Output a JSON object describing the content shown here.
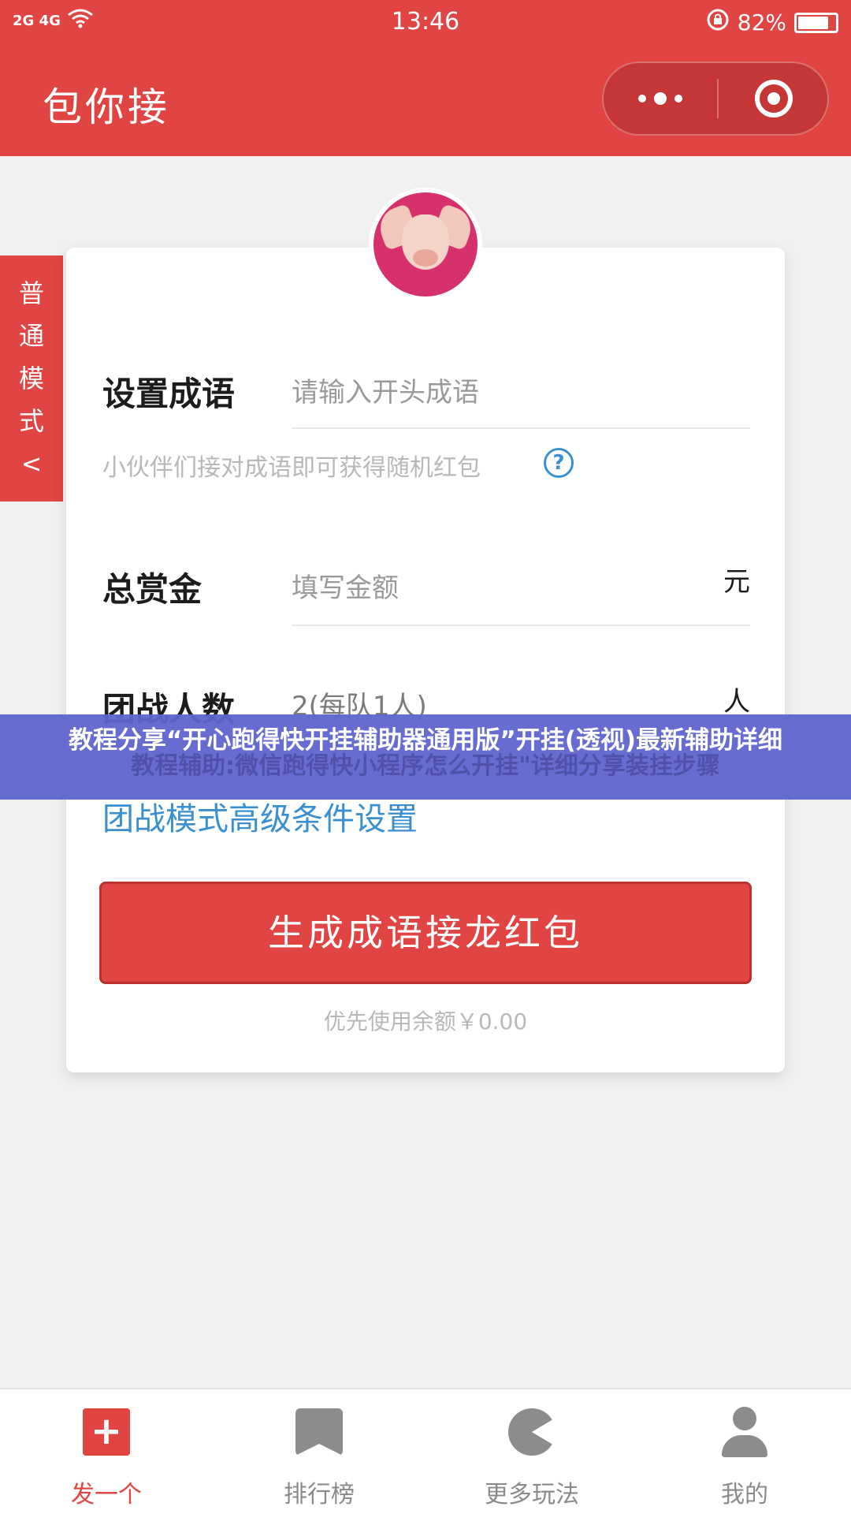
{
  "status_bar": {
    "network": "2G 4G",
    "time": "13:46",
    "battery_percent": "82%",
    "battery_level": 0.82
  },
  "header": {
    "title": "包你接"
  },
  "side_tab": {
    "chars": [
      "普",
      "通",
      "模",
      "式",
      "<"
    ]
  },
  "form": {
    "idiom_label": "设置成语",
    "idiom_placeholder": "请输入开头成语",
    "hint": "小伙伴们接对成语即可获得随机红包",
    "help_icon": "?",
    "amount_label": "总赏金",
    "amount_placeholder": "填写金额",
    "amount_unit": "元",
    "people_label": "团战人数",
    "people_value": "2(每队1人)",
    "people_unit": "人",
    "advanced_link": "团战模式高级条件设置",
    "submit_button": "生成成语接龙红包",
    "balance_text": "优先使用余额￥0.00"
  },
  "banner": {
    "title": "教程分享“开心跑得快开挂辅助器通用版”开挂(透视)最新辅助详细",
    "ghost_text": "教程辅助:微信跑得快小程序怎么开挂\"详细分享装挂步骤"
  },
  "bottom_nav": {
    "items": [
      {
        "label": "发一个",
        "icon": "plus-icon"
      },
      {
        "label": "排行榜",
        "icon": "bookmark-icon"
      },
      {
        "label": "更多玩法",
        "icon": "pacman-icon"
      },
      {
        "label": "我的",
        "icon": "user-icon"
      }
    ],
    "active_color": "#e04443"
  },
  "colors": {
    "brand_red": "#e04443",
    "link_blue": "#3a8fd0",
    "banner_blue": "#5f64cd"
  }
}
